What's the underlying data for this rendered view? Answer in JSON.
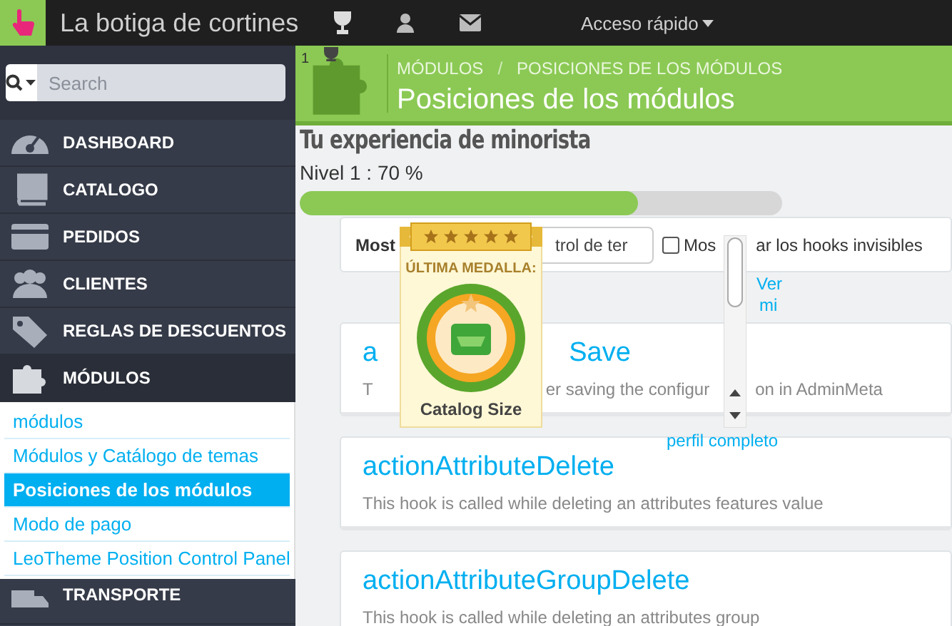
{
  "topbar": {
    "shop_name": "La botiga de cortines",
    "quick_access": "Acceso rápido"
  },
  "sidebar": {
    "search": {
      "placeholder": "Search"
    },
    "items": [
      {
        "label": "DASHBOARD",
        "kind": "gauge",
        "selected": false
      },
      {
        "label": "CATALOGO",
        "kind": "book",
        "selected": false
      },
      {
        "label": "PEDIDOS",
        "kind": "card",
        "selected": false
      },
      {
        "label": "CLIENTES",
        "kind": "users",
        "selected": false
      },
      {
        "label": "REGLAS DE DESCUENTOS",
        "kind": "tag",
        "selected": false
      },
      {
        "label": "MÓDULOS",
        "kind": "puzzle",
        "selected": true
      }
    ],
    "submenu": [
      {
        "label": "módulos",
        "selected": false
      },
      {
        "label": "Módulos y Catálogo de temas",
        "selected": false
      },
      {
        "label": "Posiciones de los módulos",
        "selected": true
      },
      {
        "label": "Modo de pago",
        "selected": false
      },
      {
        "label": "LeoTheme Position Control Panel",
        "selected": false
      }
    ],
    "next_item": {
      "label": "TRANSPORTE",
      "kind": "truck"
    }
  },
  "header": {
    "breadcrumb": [
      "MÓDULOS",
      "POSICIONES DE LOS MÓDULOS"
    ],
    "breadcrumb_separator": "/",
    "title": "Posiciones de los módulos"
  },
  "filter": {
    "label": "Most",
    "select_value": "trol de ter",
    "checkbox": {
      "checked": false,
      "label_parts": [
        "Mos",
        "ar los hooks invisibles"
      ]
    }
  },
  "hooks": [
    {
      "title_parts": [
        "a",
        "Save"
      ],
      "description_parts": [
        "T",
        "er saving the configur",
        "on in AdminMeta"
      ]
    },
    {
      "title_parts": [
        "actionAttributeDelete"
      ],
      "description_parts": [
        "This hook is called while deleting an attributes features value"
      ]
    },
    {
      "title_parts": [
        "actionAttributeGroupDelete"
      ],
      "description_parts": [
        "This hook is called while deleting an attributes group"
      ]
    }
  ],
  "experience": {
    "badge_count": "1",
    "title": "Tu experiencia de minorista",
    "level_text": "Nivel 1 : 70 %",
    "level": 0.7,
    "profile_link_parts": [
      "Ver",
      "mi",
      "perfil completo"
    ]
  },
  "medal": {
    "heading": "ÚLTIMA MEDALLA:",
    "name": "Catalog Size",
    "stars": 5
  }
}
